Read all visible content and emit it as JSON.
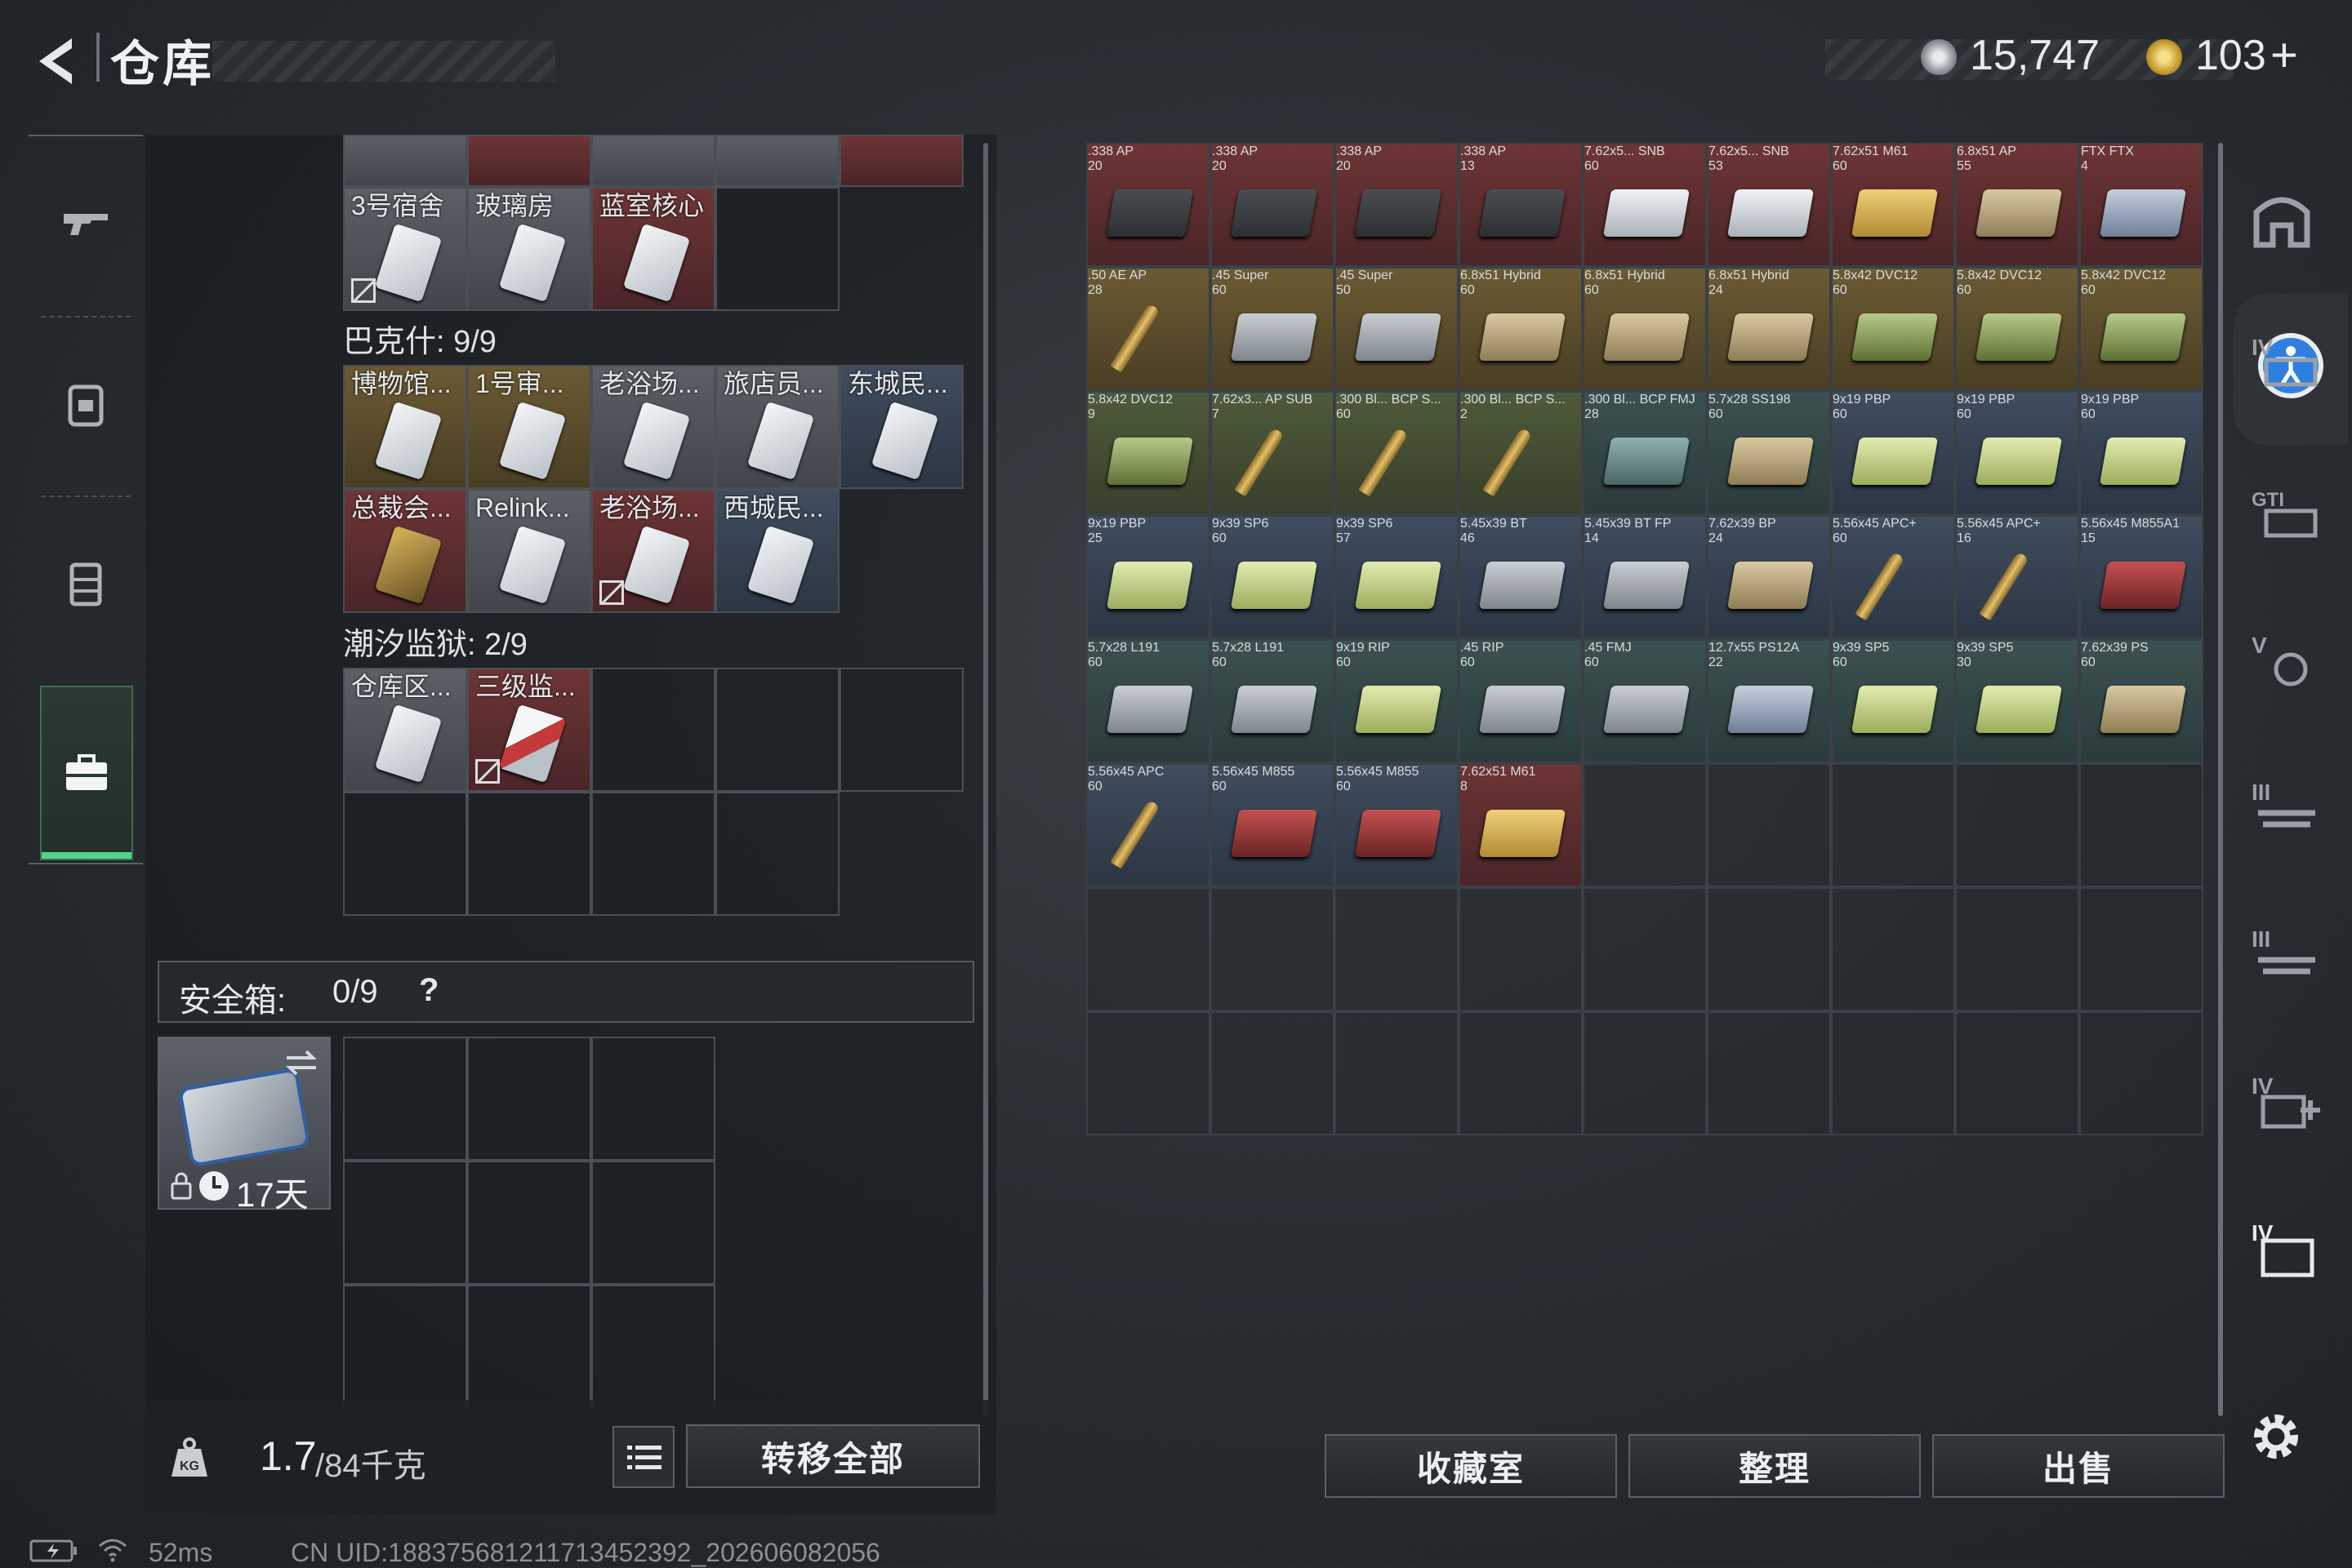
{
  "header": {
    "title": "仓库",
    "currency_silver": "15,747",
    "currency_gold": "103",
    "currency_gold_plus": "+"
  },
  "left_nav": {
    "items": [
      "weapon",
      "backpack",
      "vest",
      "case"
    ],
    "selected": "case"
  },
  "left_panel": {
    "section_top": {
      "items": [
        {
          "name": "3号宿舍",
          "color": "gray",
          "locked": true
        },
        {
          "name": "玻璃房",
          "color": "gray",
          "locked": false
        },
        {
          "name": "蓝室核心",
          "color": "red",
          "locked": false
        }
      ]
    },
    "section_bakshi": {
      "label": "巴克什: 9/9",
      "items": [
        {
          "name": "博物馆...",
          "color": "gold"
        },
        {
          "name": "1号审...",
          "color": "gold"
        },
        {
          "name": "老浴场...",
          "color": "gray"
        },
        {
          "name": "旅店员...",
          "color": "gray"
        },
        {
          "name": "东城民...",
          "color": "blue"
        },
        {
          "name": "总裁会...",
          "color": "red",
          "card": "gold"
        },
        {
          "name": "Relink...",
          "color": "gray"
        },
        {
          "name": "老浴场...",
          "color": "red",
          "locked": true
        },
        {
          "name": "西城民...",
          "color": "blue"
        }
      ]
    },
    "section_prison": {
      "label": "潮汐监狱: 2/9",
      "items": [
        {
          "name": "仓库区...",
          "color": "gray"
        },
        {
          "name": "三级监...",
          "color": "red",
          "locked": true,
          "card": "redstripe"
        }
      ]
    },
    "safe_box": {
      "label": "安全箱:",
      "count": "0/9",
      "help": "?",
      "timer": "17天"
    },
    "weight": {
      "current": "1.7",
      "max": "/84千克"
    },
    "transfer_all": "转移全部"
  },
  "stash": {
    "items": [
      {
        "name": ".338\nAP",
        "count": "20",
        "color": "red",
        "kind": "box-dark"
      },
      {
        "name": ".338\nAP",
        "count": "20",
        "color": "red",
        "kind": "box-dark"
      },
      {
        "name": ".338\nAP",
        "count": "20",
        "color": "red",
        "kind": "box-dark"
      },
      {
        "name": ".338\nAP",
        "count": "13",
        "color": "red",
        "kind": "box-dark"
      },
      {
        "name": "7.62x5...\nSNB",
        "count": "60",
        "color": "red",
        "kind": "box-white"
      },
      {
        "name": "7.62x5...\nSNB",
        "count": "53",
        "color": "red",
        "kind": "box-white"
      },
      {
        "name": "7.62x51\nM61",
        "count": "60",
        "color": "red",
        "kind": "box-gold"
      },
      {
        "name": "6.8x51\nAP",
        "count": "55",
        "color": "red",
        "kind": "box-tan"
      },
      {
        "name": "FTX\nFTX",
        "count": "4",
        "color": "red",
        "kind": "box-blue"
      },
      {
        "name": ".50 AE\nAP",
        "count": "28",
        "color": "gold",
        "kind": "bullet"
      },
      {
        "name": ".45\nSuper",
        "count": "60",
        "color": "gold",
        "kind": "box-gray"
      },
      {
        "name": ".45\nSuper",
        "count": "50",
        "color": "gold",
        "kind": "box-gray"
      },
      {
        "name": "6.8x51\nHybrid",
        "count": "60",
        "color": "gold",
        "kind": "box-tan"
      },
      {
        "name": "6.8x51\nHybrid",
        "count": "60",
        "color": "gold",
        "kind": "box-tan"
      },
      {
        "name": "6.8x51\nHybrid",
        "count": "24",
        "color": "gold",
        "kind": "box-tan"
      },
      {
        "name": "5.8x42\nDVC12",
        "count": "60",
        "color": "gold",
        "kind": "box-green"
      },
      {
        "name": "5.8x42\nDVC12",
        "count": "60",
        "color": "gold",
        "kind": "box-green"
      },
      {
        "name": "5.8x42\nDVC12",
        "count": "60",
        "color": "gold",
        "kind": "box-green"
      },
      {
        "name": "5.8x42\nDVC12",
        "count": "9",
        "color": "green",
        "kind": "box-green"
      },
      {
        "name": "7.62x3...\nAP SUB",
        "count": "7",
        "color": "green",
        "kind": "bullet"
      },
      {
        "name": ".300 Bl...\nBCP S...",
        "count": "60",
        "color": "green",
        "kind": "bullet"
      },
      {
        "name": ".300 Bl...\nBCP S...",
        "count": "2",
        "color": "green",
        "kind": "bullet"
      },
      {
        "name": ".300 Bl...\nBCP FMJ",
        "count": "28",
        "color": "teal",
        "kind": "box-teal"
      },
      {
        "name": "5.7x28\nSS198",
        "count": "60",
        "color": "teal",
        "kind": "box-tan"
      },
      {
        "name": "9x19\nPBP",
        "count": "60",
        "color": "blue",
        "kind": "box-lime"
      },
      {
        "name": "9x19\nPBP",
        "count": "60",
        "color": "blue",
        "kind": "box-lime"
      },
      {
        "name": "9x19\nPBP",
        "count": "60",
        "color": "blue",
        "kind": "box-lime"
      },
      {
        "name": "9x19\nPBP",
        "count": "25",
        "color": "blue",
        "kind": "box-lime"
      },
      {
        "name": "9x39\nSP6",
        "count": "60",
        "color": "blue",
        "kind": "box-lime"
      },
      {
        "name": "9x39\nSP6",
        "count": "57",
        "color": "blue",
        "kind": "box-lime"
      },
      {
        "name": "5.45x39\nBT",
        "count": "46",
        "color": "blue",
        "kind": "box-gray"
      },
      {
        "name": "5.45x39\nBT FP",
        "count": "14",
        "color": "blue",
        "kind": "box-gray"
      },
      {
        "name": "7.62x39\nBP",
        "count": "24",
        "color": "blue",
        "kind": "box-tan"
      },
      {
        "name": "5.56x45\nAPC+",
        "count": "60",
        "color": "blue",
        "kind": "bullet"
      },
      {
        "name": "5.56x45\nAPC+",
        "count": "16",
        "color": "blue",
        "kind": "bullet"
      },
      {
        "name": "5.56x45\nM855A1",
        "count": "15",
        "color": "blue",
        "kind": "box-red"
      },
      {
        "name": "5.7x28\nL191",
        "count": "60",
        "color": "teal",
        "kind": "box-gray"
      },
      {
        "name": "5.7x28\nL191",
        "count": "60",
        "color": "teal",
        "kind": "box-gray"
      },
      {
        "name": "9x19\nRIP",
        "count": "60",
        "color": "teal",
        "kind": "box-lime"
      },
      {
        "name": ".45\nRIP",
        "count": "60",
        "color": "teal",
        "kind": "box-gray"
      },
      {
        "name": ".45\nFMJ",
        "count": "60",
        "color": "teal",
        "kind": "box-gray"
      },
      {
        "name": "12.7x55\nPS12A",
        "count": "22",
        "color": "teal",
        "kind": "box-blue"
      },
      {
        "name": "9x39\nSP5",
        "count": "60",
        "color": "teal",
        "kind": "box-lime"
      },
      {
        "name": "9x39\nSP5",
        "count": "30",
        "color": "teal",
        "kind": "box-lime"
      },
      {
        "name": "7.62x39\nPS",
        "count": "60",
        "color": "teal",
        "kind": "box-tan"
      },
      {
        "name": "5.56x45\nAPC",
        "count": "60",
        "color": "blue",
        "kind": "bullet"
      },
      {
        "name": "5.56x45\nM855",
        "count": "60",
        "color": "blue",
        "kind": "box-red"
      },
      {
        "name": "5.56x45\nM855",
        "count": "60",
        "color": "blue",
        "kind": "box-red"
      },
      {
        "name": "7.62x51\nM61",
        "count": "8",
        "color": "red",
        "kind": "box-gold"
      }
    ]
  },
  "right_sidebar": {
    "items": [
      "IV",
      "GTI",
      "V",
      "III",
      "III",
      "IV",
      "IV"
    ]
  },
  "bottom_buttons": {
    "collection": "收藏室",
    "organize": "整理",
    "sell": "出售"
  },
  "status_bar": {
    "ping": "52ms",
    "uid": "CN UID:18837568121171345239​2_202606082056"
  },
  "colors": {
    "accent_green": "#4fd58a",
    "rarity_red": "#6e3535",
    "rarity_gold": "#6b5a33",
    "rarity_green": "#4e5a3a",
    "rarity_blue": "#3f4d5e",
    "rarity_teal": "#3b5150"
  }
}
